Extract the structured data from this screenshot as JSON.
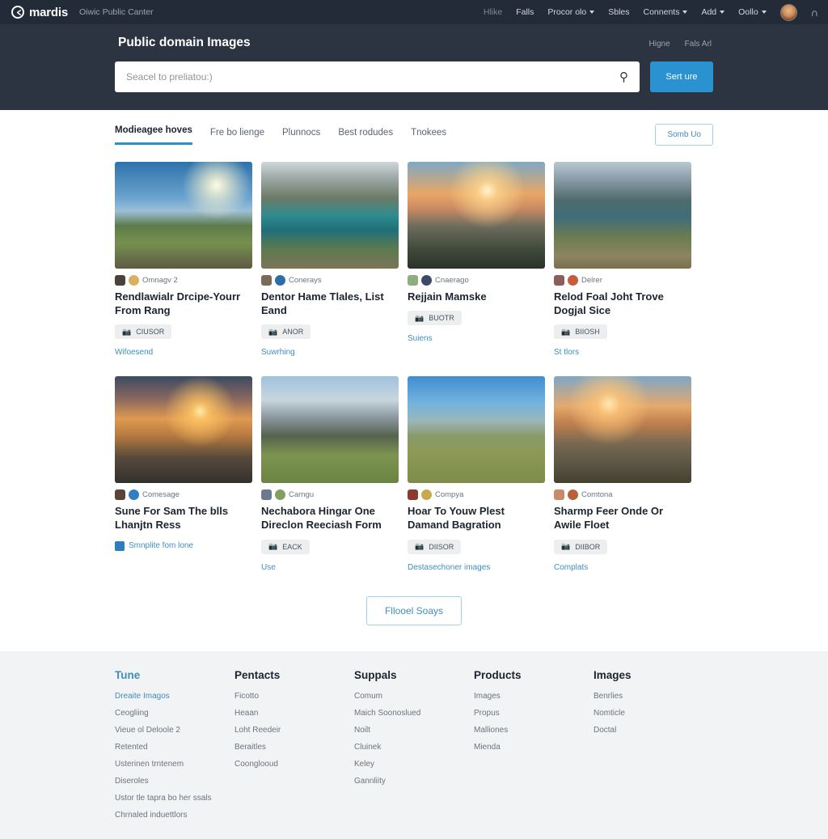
{
  "topbar": {
    "brand_name": "mardis",
    "brand_icon": "circle-arrow-logo-icon",
    "brand_subtitle": "Oiwic Public Canter",
    "nav": [
      {
        "label": "Hlike",
        "caret": false,
        "dim": true
      },
      {
        "label": "Falls",
        "caret": false,
        "dim": false
      },
      {
        "label": "Procor olo",
        "caret": true,
        "dim": false
      },
      {
        "label": "Sbles",
        "caret": false,
        "dim": false
      },
      {
        "label": "Connents",
        "caret": true,
        "dim": false
      },
      {
        "label": "Add",
        "caret": true,
        "dim": false
      },
      {
        "label": "Oollo",
        "caret": true,
        "dim": false
      }
    ],
    "avatar_name": "user-avatar",
    "bell_icon": "notification-bell-icon"
  },
  "hero": {
    "title": "Public domain Images",
    "links": [
      "Higne",
      "Fals Arl"
    ],
    "search_placeholder": "Seacel to preliatou:)",
    "search_value": "",
    "search_icon": "search-icon",
    "search_button": "Sert ure"
  },
  "tabs": {
    "items": [
      {
        "label": "Modieagee hoves",
        "active": true
      },
      {
        "label": "Fre bo lienge",
        "active": false
      },
      {
        "label": "Plunnocs",
        "active": false
      },
      {
        "label": "Best rodudes",
        "active": false
      },
      {
        "label": "Tnokees",
        "active": false
      }
    ],
    "sort_label": "Somb Uo"
  },
  "cards": [
    {
      "author": "Omnagv 2",
      "title": "Rendlawialr Drcipe-Yourr From Rang",
      "badge": "CIUSOR",
      "badge_icon": "camera-icon",
      "link": "Wifoesend",
      "link_icon": "",
      "img": "mountain-ridge-sun",
      "chips": [
        "#4a4238",
        "#d9b15e"
      ]
    },
    {
      "author": "Conerays",
      "title": "Dentor Hame Tlales, List Eand",
      "badge": "ANOR",
      "badge_icon": "camera-icon",
      "link": "Suwrhing",
      "link_icon": "",
      "img": "alpine-lake-valley",
      "chips": [
        "#7a6a58",
        "#2b6fa8"
      ]
    },
    {
      "author": "Cnaerago",
      "title": "Rejjain Mamske",
      "badge": "BUOTR",
      "badge_icon": "camera-icon",
      "link": "Suiens",
      "link_icon": "",
      "img": "sunset-fjord",
      "chips": [
        "#8fae7e",
        "#3c4a63"
      ]
    },
    {
      "author": "Delrer",
      "title": "Relod Foal Joht Trove Dogjal Sice",
      "badge": "BIIOSH",
      "badge_icon": "camera-icon",
      "link": "St tlors",
      "link_icon": "",
      "img": "lake-mountain-rocks",
      "chips": [
        "#8a5f5a",
        "#c75c3a"
      ]
    },
    {
      "author": "Comesage",
      "title": "Sune For Sam The blls Lhanjtn Ress",
      "badge": "",
      "badge_icon": "",
      "link": "Smnplite fom lone",
      "link_icon": "square-badge-icon",
      "img": "golden-sunrise-peak",
      "chips": [
        "#5a4436",
        "#2f7fc2"
      ]
    },
    {
      "author": "Carngu",
      "title": "Nechabora Hingar One Direclon Reeciash Form",
      "badge": "EACK",
      "badge_icon": "camera-icon",
      "link": "Use",
      "link_icon": "",
      "img": "snow-peaks-meadow",
      "chips": [
        "#6b7a8c",
        "#7fa05e"
      ]
    },
    {
      "author": "Compya",
      "title": "Hoar To Youw Plest Damand Bagration",
      "badge": "DIISOR",
      "badge_icon": "camera-icon",
      "link": "Destasechoner images",
      "link_icon": "",
      "img": "red-tree-hillside",
      "chips": [
        "#8c3a2e",
        "#c9a84e"
      ]
    },
    {
      "author": "Comtona",
      "title": "Sharmp Feer Onde Or Awile Floet",
      "badge": "DIIBOR",
      "badge_icon": "camera-icon",
      "link": "Complats",
      "link_icon": "",
      "img": "coastal-sunset-cliff",
      "chips": [
        "#c98a6a",
        "#b8603a"
      ]
    }
  ],
  "load_more": "Fllooel Soays",
  "footer": {
    "columns": [
      {
        "head": "Tune",
        "head_accent": true,
        "links": [
          {
            "label": "Dreaite Imagos",
            "accent": true
          },
          {
            "label": "Ceogliing",
            "accent": false
          },
          {
            "label": "Vieue ol Deloole 2",
            "accent": false
          },
          {
            "label": "Retented",
            "accent": false
          },
          {
            "label": "Usterinen trntenem",
            "accent": false
          },
          {
            "label": "Diseroles",
            "accent": false
          },
          {
            "label": "Ustor tle tapra bo her ssals",
            "accent": false
          },
          {
            "label": "Chrnaled induettlors",
            "accent": false
          }
        ]
      },
      {
        "head": "Pentacts",
        "head_accent": false,
        "links": [
          {
            "label": "Ficotto",
            "accent": false
          },
          {
            "label": "Heaan",
            "accent": false
          },
          {
            "label": "Loht Reedeir",
            "accent": false
          },
          {
            "label": "Beraitles",
            "accent": false
          },
          {
            "label": "Coonglooud",
            "accent": false
          }
        ]
      },
      {
        "head": "Suppals",
        "head_accent": false,
        "links": [
          {
            "label": "Comum",
            "accent": false
          },
          {
            "label": "Maich Soonoslued",
            "accent": false
          },
          {
            "label": "Noilt",
            "accent": false
          },
          {
            "label": "Cluinek",
            "accent": false
          },
          {
            "label": "Keley",
            "accent": false
          },
          {
            "label": "Gannliity",
            "accent": false
          }
        ]
      },
      {
        "head": "Products",
        "head_accent": false,
        "links": [
          {
            "label": "Images",
            "accent": false
          },
          {
            "label": "Propus",
            "accent": false
          },
          {
            "label": "Malliones",
            "accent": false
          },
          {
            "label": "Mienda",
            "accent": false
          }
        ]
      },
      {
        "head": "Images",
        "head_accent": false,
        "links": [
          {
            "label": "Benrlies",
            "accent": false
          },
          {
            "label": "Nomticle",
            "accent": false
          },
          {
            "label": "Doctal",
            "accent": false
          }
        ]
      }
    ]
  },
  "colors": {
    "topbar_bg": "#242b38",
    "hero_bg": "#2c3442",
    "accent": "#2a92d0",
    "link": "#3e8fbc",
    "footer_bg": "#f2f3f4"
  }
}
